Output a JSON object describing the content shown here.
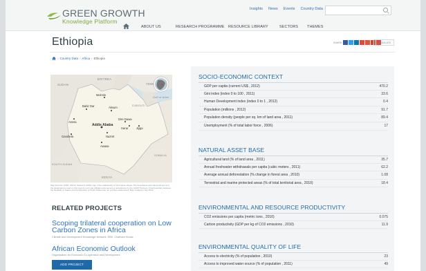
{
  "header": {
    "logo_title": "GREEN GROWTH",
    "logo_subtitle": "Knowledge Platform",
    "top_links": [
      "Insights",
      "News",
      "Events",
      "Country Data"
    ],
    "search": {
      "placeholder": "",
      "icon": "search-icon"
    },
    "main_nav": [
      "ABOUT US",
      "RESEARCH PROGRAMME",
      "RESOURCE LIBRARY",
      "SECTORS",
      "THEMES"
    ],
    "home_icon": "home-icon"
  },
  "page": {
    "title": "Ethiopia",
    "share_label": "SHARE:",
    "translate_label": "TRANSLATE",
    "share_icons": [
      "facebook-icon",
      "twitter-icon",
      "linkedin-icon",
      "googleplus-icon",
      "email-icon",
      "print-icon",
      "more-icon"
    ],
    "breadcrumb": [
      "Country Data",
      "Africa",
      "Ethiopia"
    ]
  },
  "map": {
    "labels": [
      "SUDAN",
      "ERITREA",
      "YEMEN",
      "Mek'ele",
      "Gulf of Aden",
      "Bahir Dar",
      "Aksum",
      "DJIBOUTI",
      "Dire Dawa",
      "Addis Ababa",
      "Harar",
      "Jijiga",
      "Gambela",
      "Asosa",
      "Nazret",
      "Awasa",
      "SOUTH SUDAN",
      "KENYA",
      "SOMALIA"
    ],
    "caption": "Map Sources: ESRI, UNCS. Stated at 2020s map, when statistically of information shape. The boundaries and names shown and the designations used on this map do not imply official endorsement or acceptance by the GGKP Partners. Final boundary between the Republic of Sudan and the Republic of South Sudan has not yet been determined. Map created in Sep 2013."
  },
  "related": {
    "heading": "RELATED PROJECTS",
    "items": [
      {
        "title": "Scoping trilateral cooperation on Low Carbon Zones in Africa",
        "source": "Climate and Development Knowledge Network, EBS, Chatham House"
      },
      {
        "title": "African Economic Outlook",
        "source": "Organisation for Economic Co-operation and Development"
      }
    ],
    "add_button": "ADD PROJECT"
  },
  "sections": [
    {
      "heading": "SOCIO-ECONOMIC CONTEXT",
      "rows": [
        {
          "label": "GDP per capita (current US$ , 2012)",
          "value": "470.2"
        },
        {
          "label": "Gini index (index 0 to 100 , 2011)",
          "value": "33.6"
        },
        {
          "label": "Human Development index (index 0 to 1 , 2012)",
          "value": "0.4"
        },
        {
          "label": "Population (millions , 2012)",
          "value": "91.7"
        },
        {
          "label": "Population density (people per sq. km of land area , 2011)",
          "value": "89.4"
        },
        {
          "label": "Unemployment (% of total labor force , 2006)",
          "value": "17"
        }
      ]
    },
    {
      "heading": "NATURAL ASSET BASE",
      "rows": [
        {
          "label": "Agricultural land (% of land area , 2011)",
          "value": "35.7"
        },
        {
          "label": "Annual freshwater withdrawals per capita (cubic meters , 2011)",
          "value": "62.2"
        },
        {
          "label": "Average annual deforestation (% change in forest area , 2010)",
          "value": "1.08"
        },
        {
          "label": "Terrestrial and marine protected areas (% of total territorial area , 2010)",
          "value": "18.4"
        }
      ]
    },
    {
      "heading": "ENVIRONMENTAL AND RESOURCE PRODUCTIVITY",
      "rows": [
        {
          "label": "CO2 emissions per capita (metric tons , 2010)",
          "value": "0.075"
        },
        {
          "label": "Carbon productivity (GDP per kg of CO2 emissions , 2010)",
          "value": "11.9"
        }
      ]
    },
    {
      "heading": "ENVIRONMENTAL QUALITY OF LIFE",
      "rows": [
        {
          "label": "Access to electricity (% of population , 2010)",
          "value": "23"
        },
        {
          "label": "Access to improved water source (% of population , 2011)",
          "value": "49"
        }
      ]
    }
  ],
  "colors": {
    "accent_blue": "#1e6aa8",
    "link_blue": "#2e73c4",
    "logo_green": "#7cab3c",
    "panel_bg": "#f3f4f5"
  }
}
